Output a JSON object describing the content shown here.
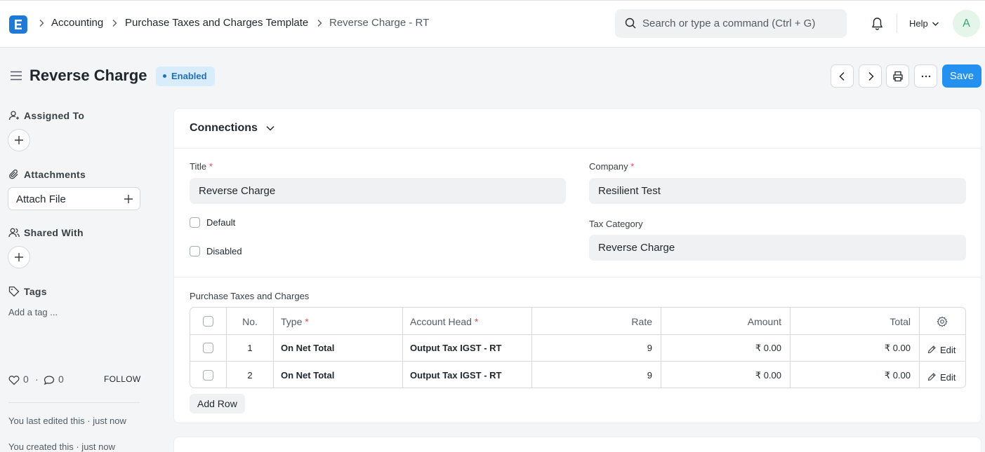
{
  "navbar": {
    "breadcrumbs": [
      "Accounting",
      "Purchase Taxes and Charges Template",
      "Reverse Charge - RT"
    ],
    "search_placeholder": "Search or type a command (Ctrl + G)",
    "help_label": "Help",
    "avatar_initial": "A",
    "icons": [
      "app-logo-icon",
      "chevron-right-icon",
      "search-icon",
      "bell-icon",
      "chevron-down-icon"
    ]
  },
  "page": {
    "title": "Reverse Charge",
    "status": "Enabled",
    "save_label": "Save",
    "colors": {
      "primary": "#2490ef",
      "badge_bg": "#d9ecfb",
      "badge_text": "#1f6fb8",
      "required": "#e24c4c"
    }
  },
  "sidebar": {
    "assigned_to": "Assigned To",
    "attachments": "Attachments",
    "attach_file": "Attach File",
    "shared_with": "Shared With",
    "tags": "Tags",
    "add_tag": "Add a tag ...",
    "likes": "0",
    "comments": "0",
    "follow": "FOLLOW",
    "last_edited": "You last edited this · just now",
    "created": "You created this · just now"
  },
  "form": {
    "section_title": "Connections",
    "title_label": "Title",
    "title_value": "Reverse Charge",
    "company_label": "Company",
    "company_value": "Resilient Test",
    "default_label": "Default",
    "disabled_label": "Disabled",
    "tax_category_label": "Tax Category",
    "tax_category_value": "Reverse Charge",
    "required_mark": "*"
  },
  "table": {
    "label": "Purchase Taxes and Charges",
    "headers": {
      "no": "No.",
      "type": "Type",
      "account_head": "Account Head",
      "rate": "Rate",
      "amount": "Amount",
      "total": "Total"
    },
    "rows": [
      {
        "no": "1",
        "type": "On Net Total",
        "account_head": "Output Tax IGST - RT",
        "rate": "9",
        "amount": "₹ 0.00",
        "total": "₹ 0.00",
        "edit": "Edit"
      },
      {
        "no": "2",
        "type": "On Net Total",
        "account_head": "Output Tax IGST - RT",
        "rate": "9",
        "amount": "₹ 0.00",
        "total": "₹ 0.00",
        "edit": "Edit"
      }
    ],
    "add_row": "Add Row"
  }
}
